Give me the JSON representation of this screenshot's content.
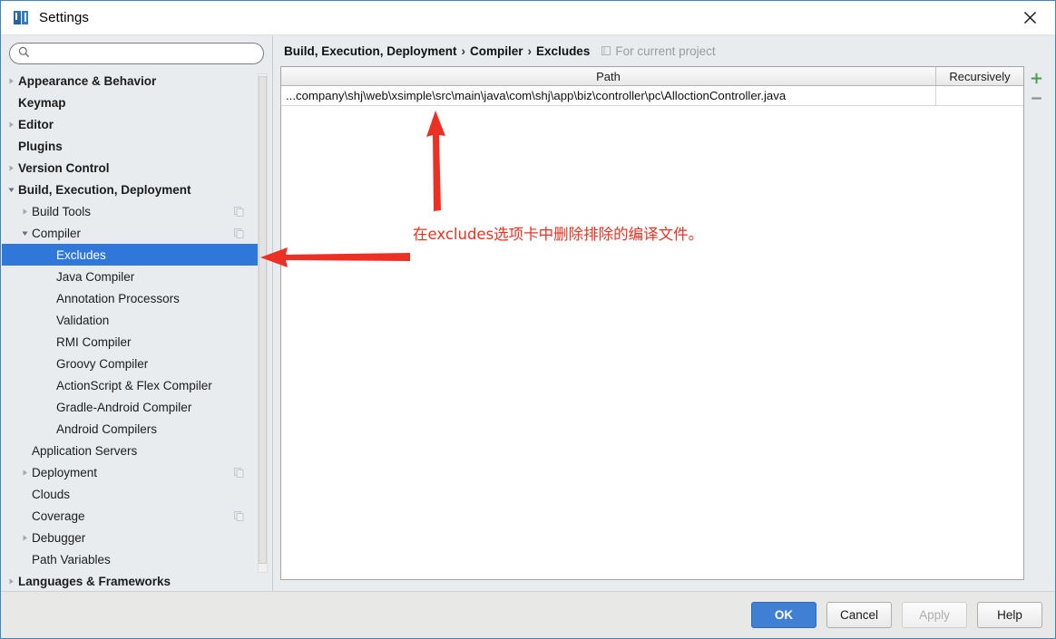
{
  "window": {
    "title": "Settings",
    "app_icon": "intellij-idea-icon",
    "close_icon": "close-icon",
    "accent_color": "#3c84c4"
  },
  "search": {
    "placeholder": "",
    "value": "",
    "icon": "search-icon"
  },
  "sidebar": {
    "items": [
      {
        "label": "Appearance & Behavior",
        "level": 0,
        "bold": true,
        "twisty": "collapsed",
        "copy_icon": false,
        "selected": false
      },
      {
        "label": "Keymap",
        "level": 0,
        "bold": true,
        "twisty": "none",
        "copy_icon": false,
        "selected": false
      },
      {
        "label": "Editor",
        "level": 0,
        "bold": true,
        "twisty": "collapsed",
        "copy_icon": false,
        "selected": false
      },
      {
        "label": "Plugins",
        "level": 0,
        "bold": true,
        "twisty": "none",
        "copy_icon": false,
        "selected": false
      },
      {
        "label": "Version Control",
        "level": 0,
        "bold": true,
        "twisty": "collapsed",
        "copy_icon": false,
        "selected": false
      },
      {
        "label": "Build, Execution, Deployment",
        "level": 0,
        "bold": true,
        "twisty": "expanded",
        "copy_icon": false,
        "selected": false
      },
      {
        "label": "Build Tools",
        "level": 1,
        "bold": false,
        "twisty": "collapsed",
        "copy_icon": true,
        "selected": false
      },
      {
        "label": "Compiler",
        "level": 1,
        "bold": false,
        "twisty": "expanded",
        "copy_icon": true,
        "selected": false
      },
      {
        "label": "Excludes",
        "level": 2,
        "bold": false,
        "twisty": "none",
        "copy_icon": false,
        "selected": true
      },
      {
        "label": "Java Compiler",
        "level": 2,
        "bold": false,
        "twisty": "none",
        "copy_icon": false,
        "selected": false
      },
      {
        "label": "Annotation Processors",
        "level": 2,
        "bold": false,
        "twisty": "none",
        "copy_icon": false,
        "selected": false
      },
      {
        "label": "Validation",
        "level": 2,
        "bold": false,
        "twisty": "none",
        "copy_icon": false,
        "selected": false
      },
      {
        "label": "RMI Compiler",
        "level": 2,
        "bold": false,
        "twisty": "none",
        "copy_icon": false,
        "selected": false
      },
      {
        "label": "Groovy Compiler",
        "level": 2,
        "bold": false,
        "twisty": "none",
        "copy_icon": false,
        "selected": false
      },
      {
        "label": "ActionScript & Flex Compiler",
        "level": 2,
        "bold": false,
        "twisty": "none",
        "copy_icon": false,
        "selected": false
      },
      {
        "label": "Gradle-Android Compiler",
        "level": 2,
        "bold": false,
        "twisty": "none",
        "copy_icon": false,
        "selected": false
      },
      {
        "label": "Android Compilers",
        "level": 2,
        "bold": false,
        "twisty": "none",
        "copy_icon": false,
        "selected": false
      },
      {
        "label": "Application Servers",
        "level": 1,
        "bold": false,
        "twisty": "none",
        "copy_icon": false,
        "selected": false
      },
      {
        "label": "Deployment",
        "level": 1,
        "bold": false,
        "twisty": "collapsed",
        "copy_icon": true,
        "selected": false
      },
      {
        "label": "Clouds",
        "level": 1,
        "bold": false,
        "twisty": "none",
        "copy_icon": false,
        "selected": false
      },
      {
        "label": "Coverage",
        "level": 1,
        "bold": false,
        "twisty": "none",
        "copy_icon": true,
        "selected": false
      },
      {
        "label": "Debugger",
        "level": 1,
        "bold": false,
        "twisty": "collapsed",
        "copy_icon": false,
        "selected": false
      },
      {
        "label": "Path Variables",
        "level": 1,
        "bold": false,
        "twisty": "none",
        "copy_icon": false,
        "selected": false
      },
      {
        "label": "Languages & Frameworks",
        "level": 0,
        "bold": true,
        "twisty": "collapsed",
        "copy_icon": false,
        "selected": false
      }
    ]
  },
  "content": {
    "breadcrumb": [
      "Build, Execution, Deployment",
      "Compiler",
      "Excludes"
    ],
    "breadcrumb_separator": "›",
    "scope_label": "For current project",
    "scope_icon": "module-icon",
    "table": {
      "columns": [
        "Path",
        "Recursively"
      ],
      "rows": [
        {
          "path": "...company\\shj\\web\\xsimple\\src\\main\\java\\com\\shj\\app\\biz\\controller\\pc\\AlloctionController.java",
          "recursively": ""
        }
      ]
    },
    "tools": {
      "add_label": "+",
      "add_icon": "plus-icon",
      "remove_label": "−",
      "remove_icon": "minus-icon",
      "add_color": "#4f9c57",
      "remove_color": "#8a8a8a"
    }
  },
  "annotation": {
    "text": "在excludes选项卡中删除排除的编译文件。",
    "color": "#ea3323",
    "arrows": [
      "up-arrow-to-path-row",
      "left-arrow-to-excludes-item"
    ]
  },
  "footer": {
    "buttons": [
      {
        "label": "OK",
        "style": "primary"
      },
      {
        "label": "Cancel",
        "style": "normal"
      },
      {
        "label": "Apply",
        "style": "disabled"
      },
      {
        "label": "Help",
        "style": "normal"
      }
    ]
  }
}
